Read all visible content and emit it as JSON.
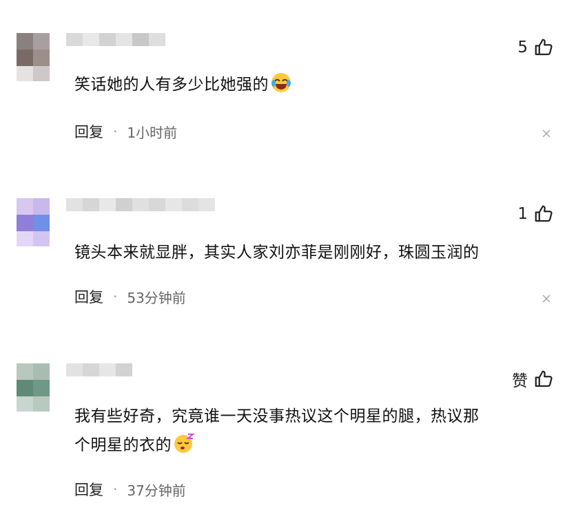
{
  "comments": [
    {
      "likes": "5",
      "text": "笑话她的人有多少比她强的",
      "emoji_icon": "laughing-tears-emoji-icon",
      "reply_label": "回复",
      "separator": "·",
      "time": "1小时前"
    },
    {
      "likes": "1",
      "text": "镜头本来就显胖，其实人家刘亦菲是刚刚好，珠圆玉润的",
      "reply_label": "回复",
      "separator": "·",
      "time": "53分钟前"
    },
    {
      "likes": "赞",
      "text_line1": "我有些好奇，究竟谁一天没事热议这个明星的腿，热议那",
      "text_line2": "个明星的衣的",
      "emoji_icon": "sleepy-face-emoji-icon",
      "reply_label": "回复",
      "separator": "·",
      "time": "37分钟前"
    }
  ],
  "icons": {
    "like": "thumbs-up-icon",
    "close": "close-icon"
  },
  "colors": {
    "meta_text": "#666666",
    "body_text": "#111111"
  }
}
